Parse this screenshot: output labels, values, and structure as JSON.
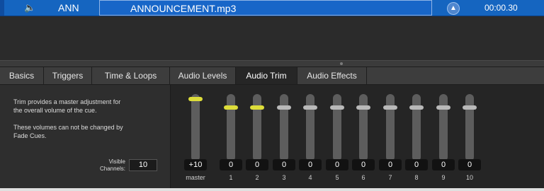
{
  "cue": {
    "speaker_icon": "speaker-icon",
    "number": "ANN",
    "name": "ANNOUNCEMENT.mp3",
    "target_icon": "arrow-up-circle-icon",
    "duration": "00:00.30",
    "accent_color": "#1565c0"
  },
  "tabs": [
    {
      "label": "Basics"
    },
    {
      "label": "Triggers"
    },
    {
      "label": "Time & Loops"
    },
    {
      "label": "Audio Levels"
    },
    {
      "label": "Audio Trim",
      "active": true
    },
    {
      "label": "Audio Effects"
    }
  ],
  "info": {
    "line1": "Trim provides a master adjustment for",
    "line2": "the overall volume of the cue.",
    "line3": "These volumes can not be changed by",
    "line4": "Fade Cues.",
    "visible_label_1": "Visible",
    "visible_label_2": "Channels:",
    "visible_value": "10"
  },
  "faders": [
    {
      "label": "master",
      "value": "+10",
      "level": 1.0,
      "highlight": true
    },
    {
      "label": "1",
      "value": "0",
      "level": 0.86,
      "highlight": true
    },
    {
      "label": "2",
      "value": "0",
      "level": 0.86,
      "highlight": true
    },
    {
      "label": "3",
      "value": "0",
      "level": 0.86,
      "highlight": false
    },
    {
      "label": "4",
      "value": "0",
      "level": 0.86,
      "highlight": false
    },
    {
      "label": "5",
      "value": "0",
      "level": 0.86,
      "highlight": false
    },
    {
      "label": "6",
      "value": "0",
      "level": 0.86,
      "highlight": false
    },
    {
      "label": "7",
      "value": "0",
      "level": 0.86,
      "highlight": false
    },
    {
      "label": "8",
      "value": "0",
      "level": 0.86,
      "highlight": false
    },
    {
      "label": "9",
      "value": "0",
      "level": 0.86,
      "highlight": false
    },
    {
      "label": "10",
      "value": "0",
      "level": 0.86,
      "highlight": false
    }
  ]
}
